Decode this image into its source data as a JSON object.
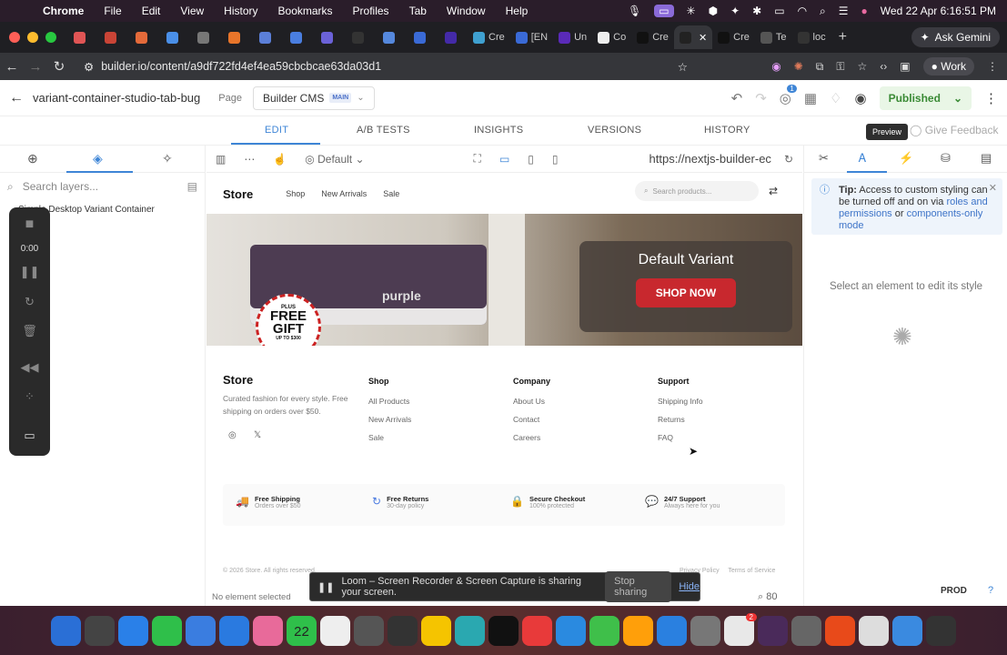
{
  "menubar": {
    "app": "Chrome",
    "items": [
      "File",
      "Edit",
      "View",
      "History",
      "Bookmarks",
      "Profiles",
      "Tab",
      "Window",
      "Help"
    ],
    "datetime": "Wed 22 Apr  6:16:51 PM"
  },
  "browser": {
    "tabs": [
      {
        "label": "",
        "color": "#e05555"
      },
      {
        "label": "",
        "color": "#c94436"
      },
      {
        "label": "",
        "color": "#e46a3a"
      },
      {
        "label": "",
        "color": "#4a8fe8"
      },
      {
        "label": "",
        "color": "#777"
      },
      {
        "label": "",
        "color": "#e8752a"
      },
      {
        "label": "",
        "color": "#5b7fd8"
      },
      {
        "label": "",
        "color": "#4a7ee0"
      },
      {
        "label": "",
        "color": "#6b62d8"
      },
      {
        "label": "",
        "color": "#333"
      },
      {
        "label": "",
        "color": "#5588dd"
      },
      {
        "label": "",
        "color": "#3a6ad6"
      },
      {
        "label": "",
        "color": "#442aa8"
      },
      {
        "label": "Cre",
        "color": "#3fa0d0"
      },
      {
        "label": "[EN",
        "color": "#3a6ad6"
      },
      {
        "label": "Un",
        "color": "#5a2ab8"
      },
      {
        "label": "Co",
        "color": "#eee"
      },
      {
        "label": "Cre",
        "color": "#111"
      },
      {
        "label": "",
        "color": "#222"
      },
      {
        "label": "Cre",
        "color": "#111"
      },
      {
        "label": "Te",
        "color": "#555"
      },
      {
        "label": "loc",
        "color": "#333"
      }
    ],
    "gemini": "Ask Gemini",
    "url": "builder.io/content/a9df722fd4ef4ea59cbcbcae63da03d1",
    "profile": "Work"
  },
  "app": {
    "content_name": "variant-container-studio-tab-bug",
    "page_label": "Page",
    "cms_label": "Builder CMS",
    "cms_badge": "MAIN",
    "notif_count": "1",
    "publish_label": "Published",
    "tabs": [
      "EDIT",
      "A/B TESTS",
      "INSIGHTS",
      "VERSIONS",
      "HISTORY"
    ],
    "preview_tooltip": "Preview",
    "give_feedback": "Give Feedback",
    "layer_search_placeholder": "Search layers...",
    "layer_item": "Simple Desktop Variant Container",
    "loom_time": "0:00",
    "device_default": "Default",
    "preview_url": "https://nextjs-builder-ec",
    "status_text": "No element selected",
    "zoom": "80",
    "tip_label": "Tip:",
    "tip_text": "Access to custom styling can be turned off and on via",
    "tip_link1": "roles and permissions",
    "tip_or": "or",
    "tip_link2": "components-only mode",
    "select_element": "Select an element to edit its style",
    "env_label": "PROD"
  },
  "store": {
    "logo": "Store",
    "nav": [
      "Shop",
      "New Arrivals",
      "Sale"
    ],
    "search_placeholder": "Search products...",
    "hero_title": "Default Variant",
    "hero_cta": "SHOP NOW",
    "hero_brand": "purple",
    "gift_top": "PLUS",
    "gift_main_1": "FREE",
    "gift_main_2": "GIFT",
    "gift_bottom": "UP TO $300",
    "footer_desc": "Curated fashion for every style. Free shipping on orders over $50.",
    "columns": [
      {
        "heading": "Shop",
        "links": [
          "All Products",
          "New Arrivals",
          "Sale"
        ]
      },
      {
        "heading": "Company",
        "links": [
          "About Us",
          "Contact",
          "Careers"
        ]
      },
      {
        "heading": "Support",
        "links": [
          "Shipping Info",
          "Returns",
          "FAQ"
        ]
      }
    ],
    "features": [
      {
        "title": "Free Shipping",
        "sub": "Orders over $50",
        "icon": "truck-icon"
      },
      {
        "title": "Free Returns",
        "sub": "30-day policy",
        "icon": "returns-icon"
      },
      {
        "title": "Secure Checkout",
        "sub": "100% protected",
        "icon": "lock-icon"
      },
      {
        "title": "24/7 Support",
        "sub": "Always here for you",
        "icon": "chat-icon"
      }
    ],
    "copyright": "© 2026 Store. All rights reserved.",
    "privacy": "Privacy Policy",
    "terms": "Terms of Service"
  },
  "loom_share": {
    "text": "Loom – Screen Recorder & Screen Capture is sharing your screen.",
    "stop": "Stop sharing",
    "hide": "Hide"
  },
  "dock": {
    "calendar_day": "22",
    "slack_badge": "2",
    "colors": [
      "#2a6fd6",
      "#444",
      "#2a80e8",
      "#2fbf4a",
      "#3a7de0",
      "#2a7ae0",
      "#e86a9a",
      "#2fbf4a",
      "#eee",
      "#555",
      "#333",
      "#f5c400",
      "#2aa8b0",
      "#111",
      "#e83a3a",
      "#2a8ae0",
      "#3fbf4a",
      "#ff9f0a",
      "#2a80e0",
      "#777",
      "#e8e8e8",
      "#4a2a5a",
      "#666",
      "#e84a1a",
      "#ddd",
      "#3a8ae0",
      "#333"
    ]
  }
}
